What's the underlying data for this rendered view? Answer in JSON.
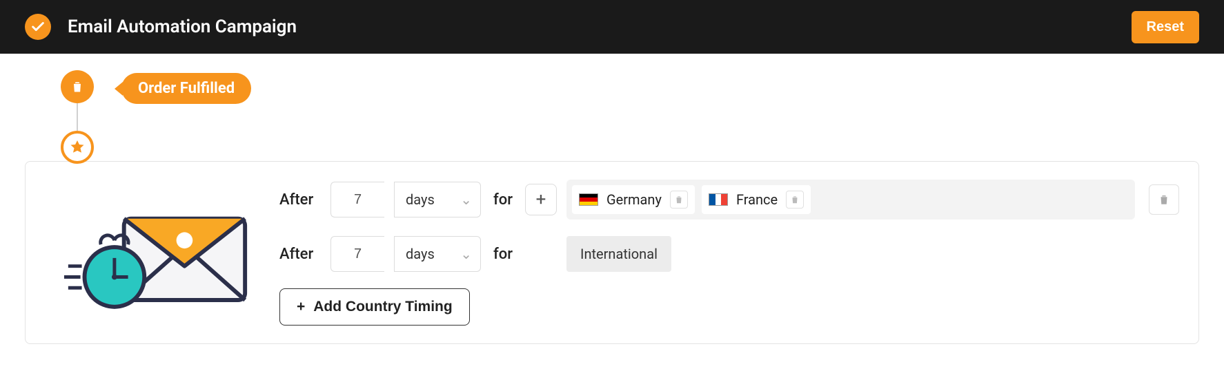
{
  "header": {
    "title": "Email Automation Campaign",
    "reset_label": "Reset"
  },
  "trigger": {
    "badge_label": "Order Fulfilled"
  },
  "step": {
    "rows": [
      {
        "after_label": "After",
        "value": "7",
        "unit": "days",
        "for_label": "for",
        "countries": [
          {
            "name": "Germany",
            "code": "de"
          },
          {
            "name": "France",
            "code": "fr"
          }
        ]
      },
      {
        "after_label": "After",
        "value": "7",
        "unit": "days",
        "for_label": "for",
        "scope_label": "International"
      }
    ],
    "add_country_label": "Add Country Timing"
  },
  "icons": {
    "plus": "+",
    "chevron_down": "⌄"
  }
}
